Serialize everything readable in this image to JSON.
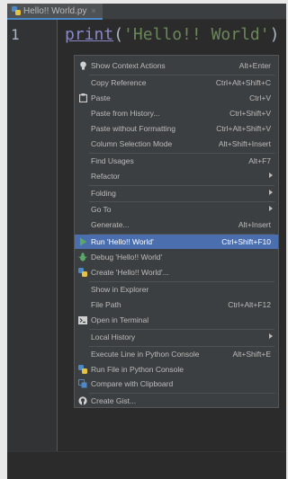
{
  "editor_tab": {
    "filename": "Hello!! World.py",
    "close_glyph": "×"
  },
  "editor": {
    "line_number": "1",
    "code": {
      "fn": "print",
      "open": "(",
      "string": "'Hello!! World'",
      "close": ")"
    }
  },
  "context_menu": {
    "items": [
      {
        "label": "Show Context Actions",
        "shortcut": "Alt+Enter",
        "icon": "lightbulb-icon"
      },
      {
        "label": "Copy Reference",
        "shortcut": "Ctrl+Alt+Shift+C",
        "icon": ""
      },
      {
        "label": "Paste",
        "shortcut": "Ctrl+V",
        "icon": "clipboard-icon"
      },
      {
        "label": "Paste from History...",
        "shortcut": "Ctrl+Shift+V",
        "icon": ""
      },
      {
        "label": "Paste without Formatting",
        "shortcut": "Ctrl+Alt+Shift+V",
        "icon": ""
      },
      {
        "label": "Column Selection Mode",
        "shortcut": "Alt+Shift+Insert",
        "icon": ""
      },
      {
        "label": "Find Usages",
        "shortcut": "Alt+F7",
        "icon": ""
      },
      {
        "label": "Refactor",
        "shortcut": "",
        "icon": "",
        "submenu": true
      },
      {
        "label": "Folding",
        "shortcut": "",
        "icon": "",
        "submenu": true
      },
      {
        "label": "Go To",
        "shortcut": "",
        "icon": "",
        "submenu": true
      },
      {
        "label": "Generate...",
        "shortcut": "Alt+Insert",
        "icon": ""
      },
      {
        "label": "Run 'Hello!! World'",
        "shortcut": "Ctrl+Shift+F10",
        "icon": "run-icon",
        "selected": true
      },
      {
        "label": "Debug 'Hello!! World'",
        "shortcut": "",
        "icon": "debug-icon"
      },
      {
        "label": "Create 'Hello!! World'...",
        "shortcut": "",
        "icon": "python-icon"
      },
      {
        "label": "Show in Explorer",
        "shortcut": "",
        "icon": ""
      },
      {
        "label": "File Path",
        "shortcut": "Ctrl+Alt+F12",
        "icon": ""
      },
      {
        "label": "Open in Terminal",
        "shortcut": "",
        "icon": "terminal-icon"
      },
      {
        "label": "Local History",
        "shortcut": "",
        "icon": "",
        "submenu": true
      },
      {
        "label": "Execute Line in Python Console",
        "shortcut": "Alt+Shift+E",
        "icon": ""
      },
      {
        "label": "Run File in Python Console",
        "shortcut": "",
        "icon": "python-icon"
      },
      {
        "label": "Compare with Clipboard",
        "shortcut": "",
        "icon": "compare-icon"
      },
      {
        "label": "Create Gist...",
        "shortcut": "",
        "icon": "github-icon"
      }
    ]
  }
}
